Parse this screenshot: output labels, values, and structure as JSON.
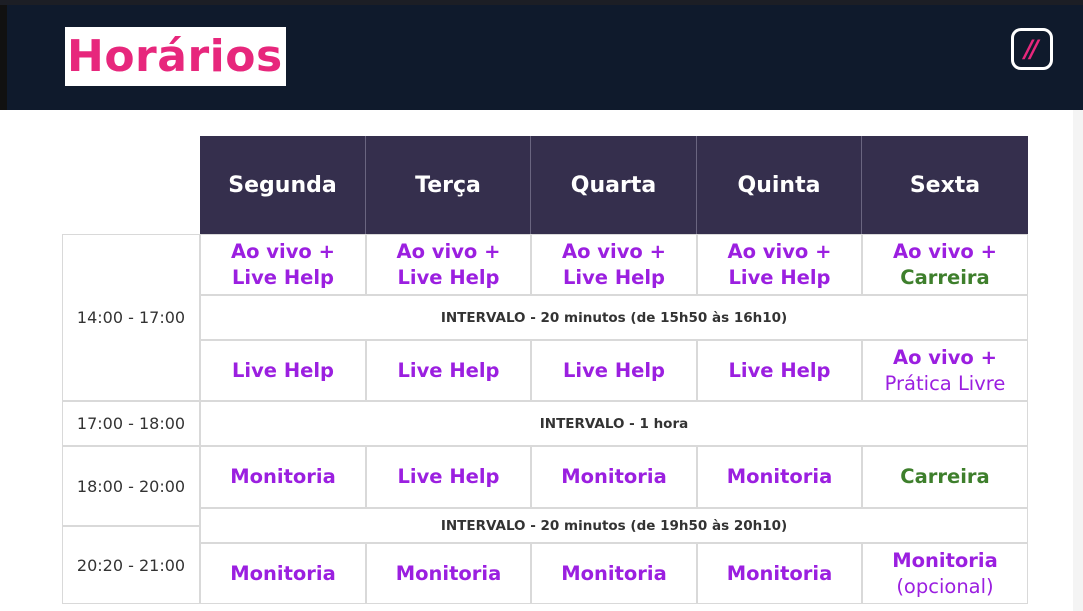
{
  "title": "Horários",
  "logo": "//",
  "days": [
    "Segunda",
    "Terça",
    "Quarta",
    "Quinta",
    "Sexta"
  ],
  "times": {
    "block1": "14:00 - 17:00",
    "block2": "17:00 - 18:00",
    "block3": "18:00 - 20:00",
    "block4": "20:20 - 21:00"
  },
  "intervals": {
    "first": "INTERVALO - 20 minutos  (de 15h50 às 16h10)",
    "hour": "INTERVALO - 1 hora",
    "second": "INTERVALO - 20 minutos  (de 19h50 às 20h10)"
  },
  "rows": {
    "r1": [
      {
        "l1": "Ao vivo +",
        "l2": "Live Help"
      },
      {
        "l1": "Ao vivo +",
        "l2": "Live Help"
      },
      {
        "l1": "Ao vivo +",
        "l2": "Live Help"
      },
      {
        "l1": "Ao vivo +",
        "l2": "Live Help"
      },
      {
        "l1": "Ao vivo +",
        "l2": "Carreira"
      }
    ],
    "r2": [
      {
        "l1": "Live Help"
      },
      {
        "l1": "Live Help"
      },
      {
        "l1": "Live Help"
      },
      {
        "l1": "Live Help"
      },
      {
        "l1": "Ao vivo +",
        "l2": "Prática Livre"
      }
    ],
    "r3": [
      {
        "l1": "Monitoria"
      },
      {
        "l1": "Live Help"
      },
      {
        "l1": "Monitoria"
      },
      {
        "l1": "Monitoria"
      },
      {
        "l1": "Carreira"
      }
    ],
    "r4": [
      {
        "l1": "Monitoria"
      },
      {
        "l1": "Monitoria"
      },
      {
        "l1": "Monitoria"
      },
      {
        "l1": "Monitoria"
      },
      {
        "l1": "Monitoria",
        "l2": "(opcional)"
      }
    ]
  },
  "colors": {
    "title_pink": "#e7277c",
    "header_bg": "#0f1a2c",
    "table_header_bg": "#352f4d",
    "activity_purple": "#9b1fe0",
    "carreira_green": "#3e7f2c"
  }
}
